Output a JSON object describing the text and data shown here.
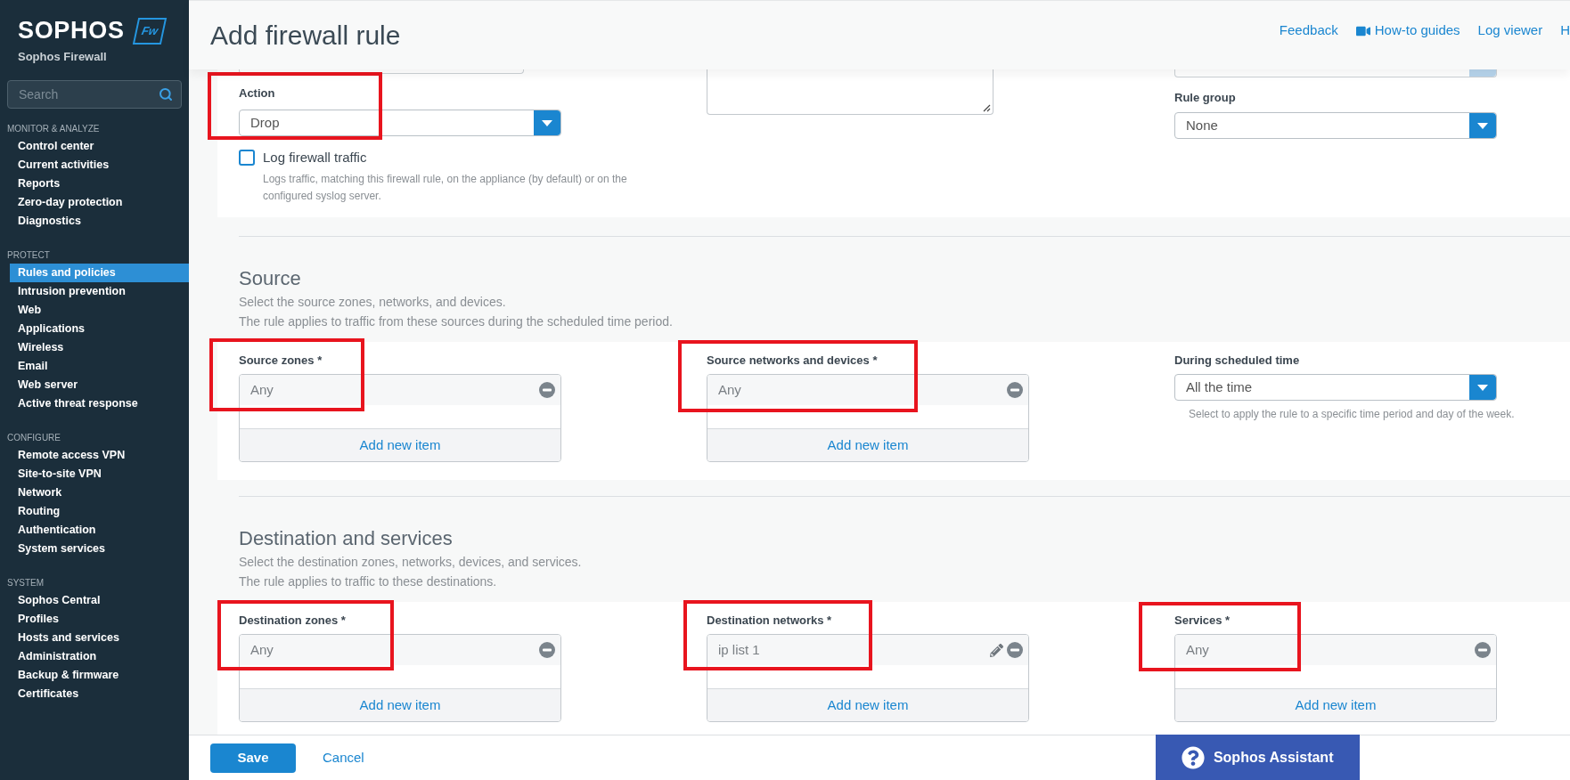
{
  "brand": {
    "logo": "SOPHOS",
    "badge": "Fw",
    "product": "Sophos Firewall"
  },
  "search": {
    "placeholder": "Search"
  },
  "sidebar": {
    "groups": [
      {
        "title": "MONITOR & ANALYZE",
        "items": [
          {
            "label": "Control center",
            "selected": false
          },
          {
            "label": "Current activities",
            "selected": false
          },
          {
            "label": "Reports",
            "selected": false
          },
          {
            "label": "Zero-day protection",
            "selected": false
          },
          {
            "label": "Diagnostics",
            "selected": false
          }
        ]
      },
      {
        "title": "PROTECT",
        "items": [
          {
            "label": "Rules and policies",
            "selected": true
          },
          {
            "label": "Intrusion prevention",
            "selected": false
          },
          {
            "label": "Web",
            "selected": false
          },
          {
            "label": "Applications",
            "selected": false
          },
          {
            "label": "Wireless",
            "selected": false
          },
          {
            "label": "Email",
            "selected": false
          },
          {
            "label": "Web server",
            "selected": false
          },
          {
            "label": "Active threat response",
            "selected": false
          }
        ]
      },
      {
        "title": "CONFIGURE",
        "items": [
          {
            "label": "Remote access VPN",
            "selected": false
          },
          {
            "label": "Site-to-site VPN",
            "selected": false
          },
          {
            "label": "Network",
            "selected": false
          },
          {
            "label": "Routing",
            "selected": false
          },
          {
            "label": "Authentication",
            "selected": false
          },
          {
            "label": "System services",
            "selected": false
          }
        ]
      },
      {
        "title": "SYSTEM",
        "items": [
          {
            "label": "Sophos Central",
            "selected": false
          },
          {
            "label": "Profiles",
            "selected": false
          },
          {
            "label": "Hosts and services",
            "selected": false
          },
          {
            "label": "Administration",
            "selected": false
          },
          {
            "label": "Backup & firmware",
            "selected": false
          },
          {
            "label": "Certificates",
            "selected": false
          }
        ]
      }
    ]
  },
  "header": {
    "title": "Add firewall rule",
    "links": [
      {
        "label": "Feedback",
        "kind": "text"
      },
      {
        "label": "How-to guides",
        "kind": "video"
      },
      {
        "label": "Log viewer",
        "kind": "text"
      },
      {
        "label": "H",
        "kind": "text"
      }
    ]
  },
  "rule": {
    "action": {
      "label": "Action",
      "value": "Drop"
    },
    "log": {
      "label": "Log firewall traffic",
      "checked": false,
      "hint": "Logs traffic, matching this firewall rule, on the appliance (by default) or on the configured syslog server."
    },
    "rule_group": {
      "label": "Rule group",
      "value": "None"
    }
  },
  "sections": [
    {
      "title": "Source",
      "description": [
        "Select the source zones, networks, and devices.",
        "The rule applies to traffic from these sources during the scheduled time period."
      ],
      "fields": [
        {
          "kind": "list",
          "label": "Source zones *",
          "items": [
            {
              "text": "Any",
              "editable": false
            }
          ],
          "add": "Add new item"
        },
        {
          "kind": "list",
          "label": "Source networks and devices *",
          "items": [
            {
              "text": "Any",
              "editable": false
            }
          ],
          "add": "Add new item"
        },
        {
          "kind": "select",
          "label": "During scheduled time",
          "value": "All the time",
          "hint": "Select to apply the rule to a specific time period and day of the week."
        }
      ]
    },
    {
      "title": "Destination and services",
      "description": [
        "Select the destination zones, networks, devices, and services.",
        "The rule applies to traffic to these destinations."
      ],
      "fields": [
        {
          "kind": "list",
          "label": "Destination zones *",
          "items": [
            {
              "text": "Any",
              "editable": false
            }
          ],
          "add": "Add new item"
        },
        {
          "kind": "list",
          "label": "Destination networks *",
          "items": [
            {
              "text": "ip list 1",
              "editable": true
            }
          ],
          "add": "Add new item"
        },
        {
          "kind": "list",
          "label": "Services *",
          "items": [
            {
              "text": "Any",
              "editable": false
            }
          ],
          "add": "Add new item"
        }
      ]
    }
  ],
  "footer": {
    "save": "Save",
    "cancel": "Cancel",
    "assistant": "Sophos Assistant"
  }
}
